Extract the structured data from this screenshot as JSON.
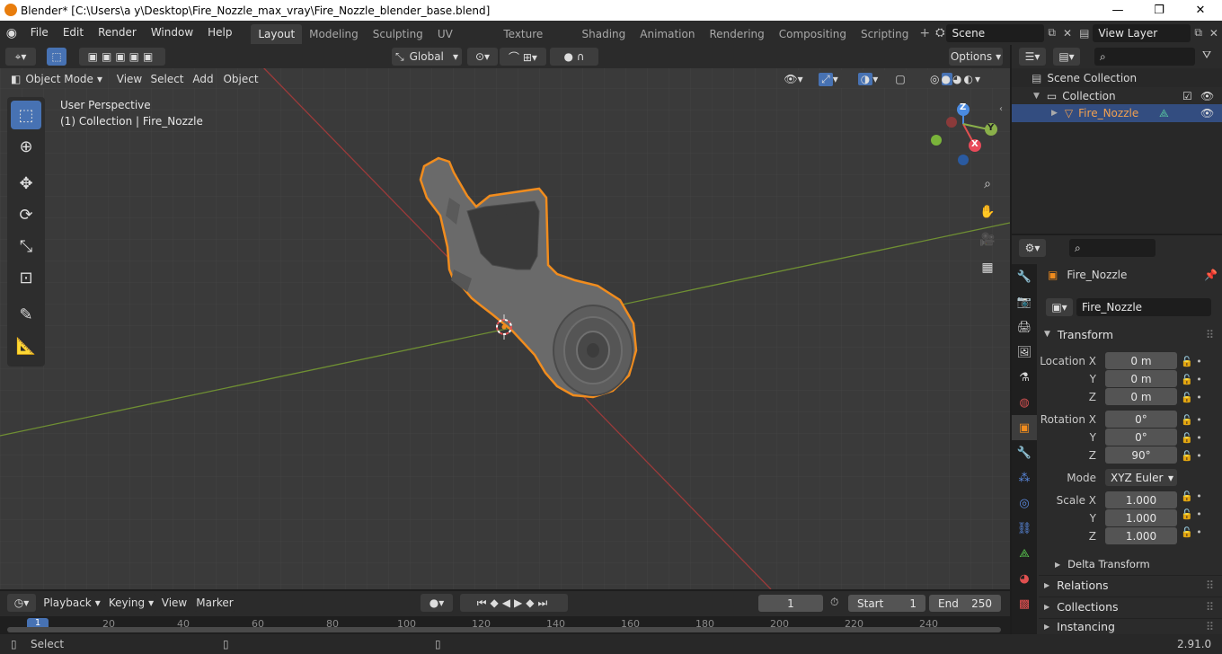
{
  "window": {
    "title": "Blender* [C:\\Users\\a y\\Desktop\\Fire_Nozzle_max_vray\\Fire_Nozzle_blender_base.blend]",
    "minimize": "—",
    "maximize": "❐",
    "close": "✕"
  },
  "menus": [
    "File",
    "Edit",
    "Render",
    "Window",
    "Help"
  ],
  "workspaces": [
    "Layout",
    "Modeling",
    "Sculpting",
    "UV Editing",
    "Texture Paint",
    "Shading",
    "Animation",
    "Rendering",
    "Compositing",
    "Scripting"
  ],
  "active_workspace": "Layout",
  "scene": {
    "name": "Scene"
  },
  "view_layer": {
    "name": "View Layer"
  },
  "viewport_header": {
    "orientation": "Global",
    "options": "Options",
    "mode": "Object Mode",
    "menus": [
      "View",
      "Select",
      "Add",
      "Object"
    ]
  },
  "viewport": {
    "perspective": "User Perspective",
    "collection_info": "(1) Collection | Fire_Nozzle",
    "gizmo": {
      "z": "Z",
      "y": "Y",
      "x": "X"
    }
  },
  "outliner": {
    "items": [
      {
        "label": "Scene Collection"
      },
      {
        "label": "Collection"
      },
      {
        "label": "Fire_Nozzle"
      }
    ]
  },
  "properties": {
    "object_name": "Fire_Nozzle",
    "data_name": "Fire_Nozzle",
    "transform_header": "Transform",
    "location_label": "Location X",
    "location": [
      "0 m",
      "0 m",
      "0 m"
    ],
    "rotation_label": "Rotation X",
    "rotation": [
      "0°",
      "0°",
      "90°"
    ],
    "mode_label": "Mode",
    "mode_value": "XYZ Euler",
    "scale_label": "Scale X",
    "scale": [
      "1.000",
      "1.000",
      "1.000"
    ],
    "axis_y": "Y",
    "axis_z": "Z",
    "panels": [
      "Delta Transform",
      "Relations",
      "Collections",
      "Instancing"
    ]
  },
  "timeline": {
    "menus": [
      "Playback",
      "Keying",
      "View",
      "Marker"
    ],
    "current_frame": "1",
    "start_label": "Start",
    "start": "1",
    "end_label": "End",
    "end": "250",
    "ruler": [
      "1",
      "20",
      "40",
      "60",
      "80",
      "100",
      "120",
      "140",
      "160",
      "180",
      "200",
      "220",
      "240"
    ]
  },
  "status": {
    "left": "Select",
    "version": "2.91.0"
  },
  "colors": {
    "accent": "#4772b3",
    "selection_outline": "#f08c1e",
    "x_axis": "#c84545",
    "y_axis": "#7da83a"
  }
}
